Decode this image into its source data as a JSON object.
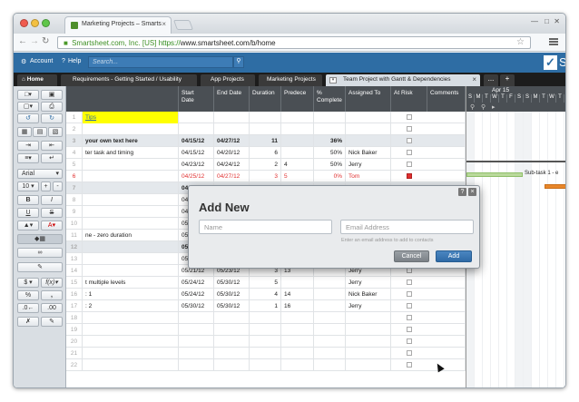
{
  "browser": {
    "tab_title": "Marketing Projects – Smarts",
    "tab_close": "×",
    "url_cert": "Smartsheet.com, Inc. [US]",
    "url_https": "https://",
    "url_rest": "www.smartsheet.com/b/home"
  },
  "header": {
    "account_label": "Account",
    "help_label": "Help",
    "search_placeholder": "Search...",
    "logo_letter": "S"
  },
  "sheet_tabs": [
    {
      "label": "Home"
    },
    {
      "label": "Requirements - Getting Started / Usability"
    },
    {
      "label": "App Projects"
    },
    {
      "label": "Marketing Projects"
    },
    {
      "label": "Team Project with Gantt & Dependencies",
      "active": true
    }
  ],
  "tab_more": "...",
  "tab_add": "+",
  "toolbar": {
    "font_name": "Arial",
    "font_size": "10",
    "bold": "B",
    "italic": "I",
    "underline": "U",
    "strike": "S",
    "currency": "$",
    "fx": "f(x)",
    "percent": "%",
    "comma": ","
  },
  "columns": [
    {
      "label": ""
    },
    {
      "label": "Start\nDate"
    },
    {
      "label": "End Date"
    },
    {
      "label": "Duration"
    },
    {
      "label": "Predece"
    },
    {
      "label": "%\nComplete"
    },
    {
      "label": "Assigned To"
    },
    {
      "label": "At Risk"
    },
    {
      "label": "Comments"
    }
  ],
  "rows": [
    {
      "num": "1",
      "task": "Tips",
      "start": "",
      "end": "",
      "dur": "",
      "pred": "",
      "pct": "",
      "assigned": "",
      "highlight": true
    },
    {
      "num": "2",
      "task": "",
      "start": "",
      "end": "",
      "dur": "",
      "pred": "",
      "pct": "",
      "assigned": ""
    },
    {
      "num": "3",
      "task": "your own text here",
      "start": "04/15/12",
      "end": "04/27/12",
      "dur": "11",
      "pred": "",
      "pct": "36%",
      "assigned": "",
      "bold": true,
      "sub": true
    },
    {
      "num": "4",
      "task": "ter task and timing",
      "start": "04/15/12",
      "end": "04/20/12",
      "dur": "6",
      "pred": "",
      "pct": "50%",
      "assigned": "Nick Baker"
    },
    {
      "num": "5",
      "task": "",
      "start": "04/23/12",
      "end": "04/24/12",
      "dur": "2",
      "pred": "4",
      "pct": "50%",
      "assigned": "Jerry"
    },
    {
      "num": "6",
      "task": "",
      "start": "04/25/12",
      "end": "04/27/12",
      "dur": "3",
      "pred": "5",
      "pct": "0%",
      "assigned": "Tom",
      "red": true
    },
    {
      "num": "7",
      "task": "",
      "start": "04/27/12",
      "end": "",
      "dur": "",
      "pred": "",
      "pct": "",
      "assigned": "",
      "bold": true,
      "sub": true
    },
    {
      "num": "8",
      "task": "",
      "start": "04/27/12",
      "end": "",
      "dur": "",
      "pred": "",
      "pct": "",
      "assigned": ""
    },
    {
      "num": "9",
      "task": "",
      "start": "04/30/12",
      "end": "",
      "dur": "",
      "pred": "",
      "pct": "",
      "assigned": ""
    },
    {
      "num": "10",
      "task": "",
      "start": "05/03/12",
      "end": "",
      "dur": "",
      "pred": "",
      "pct": "",
      "assigned": ""
    },
    {
      "num": "11",
      "task": "ne - zero duration",
      "start": "05/10/12",
      "end": "",
      "dur": "",
      "pred": "",
      "pct": "",
      "assigned": ""
    },
    {
      "num": "12",
      "task": "",
      "start": "05/16/12",
      "end": "",
      "dur": "",
      "pred": "",
      "pct": "",
      "assigned": "",
      "bold": true,
      "sub": true
    },
    {
      "num": "13",
      "task": "",
      "start": "05/16/12",
      "end": "",
      "dur": "",
      "pred": "",
      "pct": "",
      "assigned": ""
    },
    {
      "num": "14",
      "task": "",
      "start": "05/21/12",
      "end": "05/23/12",
      "dur": "3",
      "pred": "13",
      "pct": "",
      "assigned": "Jerry"
    },
    {
      "num": "15",
      "task": "t multiple levels",
      "start": "05/24/12",
      "end": "05/30/12",
      "dur": "5",
      "pred": "",
      "pct": "",
      "assigned": "Jerry"
    },
    {
      "num": "16",
      "task": ": 1",
      "start": "05/24/12",
      "end": "05/30/12",
      "dur": "4",
      "pred": "14",
      "pct": "",
      "assigned": "Nick Baker"
    },
    {
      "num": "17",
      "task": ": 2",
      "start": "05/30/12",
      "end": "05/30/12",
      "dur": "1",
      "pred": "16",
      "pct": "",
      "assigned": "Jerry"
    },
    {
      "num": "18",
      "task": "",
      "start": "",
      "end": "",
      "dur": "",
      "pred": "",
      "pct": "",
      "assigned": ""
    },
    {
      "num": "19",
      "task": "",
      "start": "",
      "end": "",
      "dur": "",
      "pred": "",
      "pct": "",
      "assigned": ""
    },
    {
      "num": "20",
      "task": "",
      "start": "",
      "end": "",
      "dur": "",
      "pred": "",
      "pct": "",
      "assigned": ""
    },
    {
      "num": "21",
      "task": "",
      "start": "",
      "end": "",
      "dur": "",
      "pred": "",
      "pct": "",
      "assigned": ""
    },
    {
      "num": "22",
      "task": "",
      "start": "",
      "end": "",
      "dur": "",
      "pred": "",
      "pct": "",
      "assigned": ""
    }
  ],
  "gantt": {
    "month_label": "Apr 15",
    "days": [
      "S",
      "M",
      "T",
      "W",
      "T",
      "F",
      "S",
      "S",
      "M",
      "T",
      "W",
      "T"
    ],
    "bar_label": "Sub-task 1 - e"
  },
  "dialog": {
    "title": "Add New",
    "help": "?",
    "close": "×",
    "name_placeholder": "Name",
    "email_placeholder": "Email Address",
    "hint": "Enter an email address to add to contacts",
    "cancel_label": "Cancel",
    "add_label": "Add"
  },
  "colors": {
    "brand_blue": "#2e6da4",
    "tab_bar": "#1c1c1c",
    "header_row": "#4a4f54",
    "highlight_yellow": "#ffff00",
    "risk_red": "#e03030",
    "gantt_green": "#b9d99b",
    "gantt_orange": "#e8862a"
  }
}
